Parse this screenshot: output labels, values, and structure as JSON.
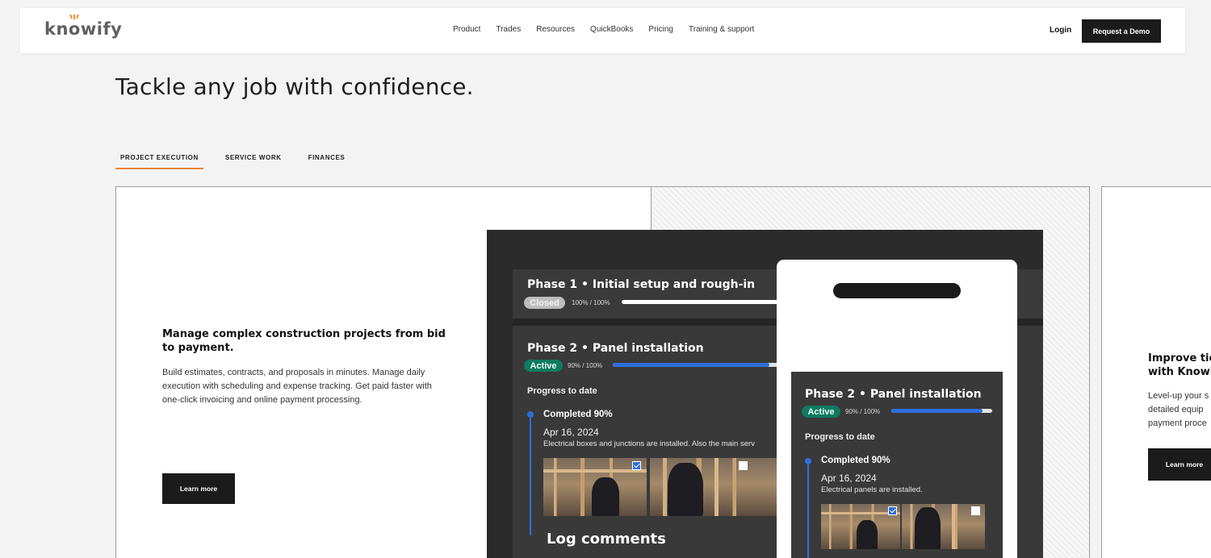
{
  "nav": {
    "logo_parts": [
      "kn",
      "o",
      "wify"
    ],
    "links": [
      "Product",
      "Trades",
      "Resources",
      "QuickBooks",
      "Pricing",
      "Training & support"
    ],
    "login": "Login",
    "demo": "Request a Demo"
  },
  "hero": {
    "headline": "Tackle any job with confidence.",
    "tabs": [
      "PROJECT EXECUTION",
      "SERVICE WORK",
      "FINANCES"
    ]
  },
  "card": {
    "title": "Manage complex construction projects from bid to payment.",
    "description": "Build estimates, contracts, and proposals in minutes. Manage daily execution with scheduling and expense tracking. Get paid faster with one-click invoicing and online payment processing.",
    "button": "Learn more"
  },
  "app": {
    "phase1": {
      "title": "Phase 1 • Initial setup and rough-in",
      "status": "Closed",
      "progress_text": "100% / 100%",
      "progress": 1.0
    },
    "phase2": {
      "title": "Phase 2 • Panel installation",
      "status": "Active",
      "progress_text": "90% / 100%",
      "progress": 0.9
    },
    "progress_label": "Progress to date",
    "entry": {
      "status": "Completed 90%",
      "date": "Apr 16, 2024",
      "note": "Electrical boxes and junctions are installed. Also the main serv"
    },
    "log_label": "Log comments",
    "colors": {
      "active": "#0f7a60",
      "closed": "#bdbdbd",
      "progress": "#2f6fdc"
    }
  },
  "phone": {
    "title": "Phase 2 • Panel installation",
    "status": "Active",
    "progress_text": "90% / 100%",
    "progress": 0.9,
    "progress_label": "Progress to date",
    "entry_status": "Completed 90%",
    "entry_date": "Apr 16, 2024",
    "entry_note": "Electrical panels are installed."
  },
  "card2": {
    "title_lines": [
      "Improve tic",
      "with Knowi"
    ],
    "desc_lines": [
      "Level-up your s",
      "detailed equip",
      "payment proce"
    ],
    "button": "Learn more"
  }
}
